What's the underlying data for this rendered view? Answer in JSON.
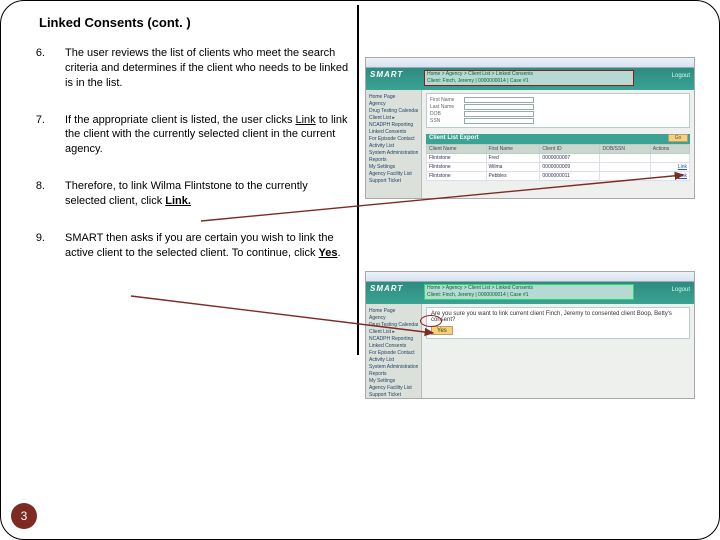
{
  "heading": "Linked Consents (cont. )",
  "steps": [
    {
      "n": "6.",
      "text": "The user reviews the list of clients who meet the search criteria and determines if the client who needs to be linked is in the list."
    },
    {
      "n": "7.",
      "pre": "If the appropriate client is listed, the user clicks ",
      "link": "Link",
      "post": " to link the client with the currently selected client in the current agency."
    },
    {
      "n": "8.",
      "pre": "Therefore, to link Wilma Flintstone to the currently selected client, click ",
      "link": "Link."
    },
    {
      "n": "9.",
      "pre": "SMART then asks if you are certain you wish to link the active client to the selected client.  To continue, click ",
      "link": "Yes",
      "post": "."
    }
  ],
  "page_number": "3",
  "app": {
    "brand": "SMART",
    "logout": "Logout",
    "crumb_line1": "Home > Agency > Client List > Linked Consents",
    "crumb_line2": "Client: Finch, Jeremy | 0000000014 | Case #1",
    "sidebar": [
      "Home Page",
      "Agency",
      "Drug Testing Calendar",
      "Client List ▸",
      "NCADPH Reporting",
      "Linked Consents",
      "For Episode Contact",
      "Activity List",
      "System Administration",
      "Reports",
      "My Settings",
      "Agency Facility List",
      "Support Ticket"
    ]
  },
  "shot1": {
    "search": {
      "first": "First Name",
      "last": "Last Name",
      "dob": "DOB",
      "ssn": "SSN",
      "go": "Go"
    },
    "list_header": "Client List  Export",
    "table": {
      "cols": [
        "Client Name",
        "First Name",
        "Client ID",
        "DOB/SSN",
        "Actions"
      ],
      "rows": [
        [
          "Flintstone",
          "Fred",
          "0000000007",
          "",
          ""
        ],
        [
          "Flintstone",
          "Wilma",
          "0000000009",
          "",
          "Link"
        ],
        [
          "Flintstone",
          "Pebbles",
          "0000000011",
          "",
          "Link"
        ]
      ]
    }
  },
  "shot2": {
    "prompt": "Are you sure you want to link current client Finch, Jeremy to consented client Boop, Betty's consent?",
    "yes": "Yes"
  }
}
